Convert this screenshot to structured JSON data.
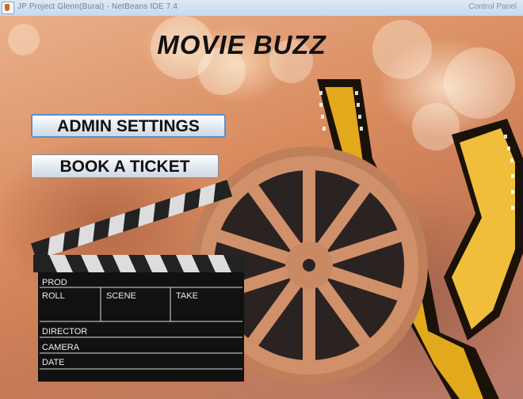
{
  "window": {
    "title": "JP Project Glenn(Burai) - NetBeans IDE 7.4",
    "title_right": "Control Panel"
  },
  "app": {
    "title": "MOVIE BUZZ"
  },
  "buttons": {
    "admin_settings": "ADMIN SETTINGS",
    "book_ticket": "BOOK A TICKET"
  },
  "clapperboard": {
    "prod": "PROD",
    "roll": "ROLL",
    "scene": "SCENE",
    "take": "TAKE",
    "director": "DIRECTOR",
    "camera": "CAMERA",
    "date": "DATE"
  },
  "colors": {
    "background": "#d98b5f",
    "reel": "#c98a63",
    "film": "#e0a81c",
    "title_text": "#111111"
  }
}
